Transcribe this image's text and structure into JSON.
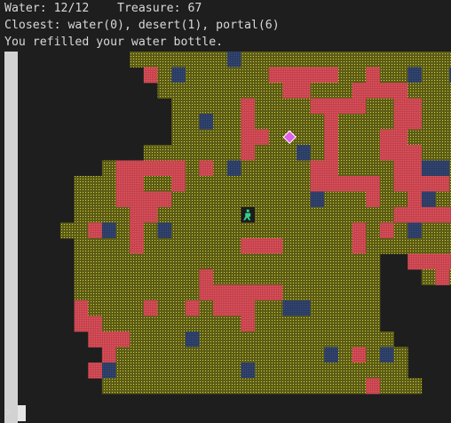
{
  "status": {
    "water_label": "Water: 12/12",
    "treasure_label": "Treasure: 67",
    "closest_text": "Closest: water(0), desert(1), portal(6)",
    "message": "You refilled your water bottle."
  },
  "prompt": ">",
  "colors": {
    "background": "#1e1e1e",
    "sand": "#5c5c18",
    "sand_dot": "#d4d434",
    "rock": "#cc4650",
    "water": "#2e3f66",
    "scrollbar": "#d2d2d2",
    "player": "#2fd38a",
    "portal": "#e060e8"
  },
  "map": {
    "legend": {
      "S": "sand",
      "R": "rock",
      "W": "water",
      "P": "portal",
      "@": "player",
      ".": "void"
    },
    "rows": [
      "........SSSSSSSWSSSSSSSSSSSSSSSS",
      ".........RSWSSSSSSRRRRRSSRSSWSSW",
      "..........SSSSSSSSSRRSSSRRRRSSSS",
      "...........SSSSSRSSSSRRRRSSRRSSS",
      "...........SSWSSRSSSSSRSSSSRRSSS",
      "...........SSSSSRRSPSSRSSSRRSSSS",
      ".........SSSSSSSRSSSWSRSSSRRRSSS",
      "......SRRRRRSRSWSSSSSRRSSSSRRWWS",
      "....SSSRRSSRSSSSSSSSSRRRRRSRRRRS",
      "....SSSRRRRSSSSSSSSSSWSSSRSSRWSS",
      "....SSSSRRSSSSSS@SSSSSSSSSSRRRRR",
      "...SSRWSRSWSSSSSSSSSSSSSRSRSWSSS",
      "....SSSSRSSSSSSSRRRSSSSSRSSSSSSS",
      "....SSSSSSSSSSSSSSSSSSSSSS..RRRR",
      "....SSSSSSSSSRSSSSSSSSSSSS...SRS",
      "....SSSSSSSSSRRRRRRSSSSSSS......",
      "....RSSSSRSSRSRRRSSWWSSSSS......",
      "....RRSSSSSSSSSSRSSSSSSSSS......",
      ".....RRRSSSSWSSSSSSSSSSSSSS.....",
      "......RSSSSSSSSSSSSSSSWSRSWS....",
      ".....RWSSSSSSSSSWSSSSSSSSSSS....",
      "......SSSSSSSSSSSSSSSSSSSRSSS...."
    ]
  }
}
